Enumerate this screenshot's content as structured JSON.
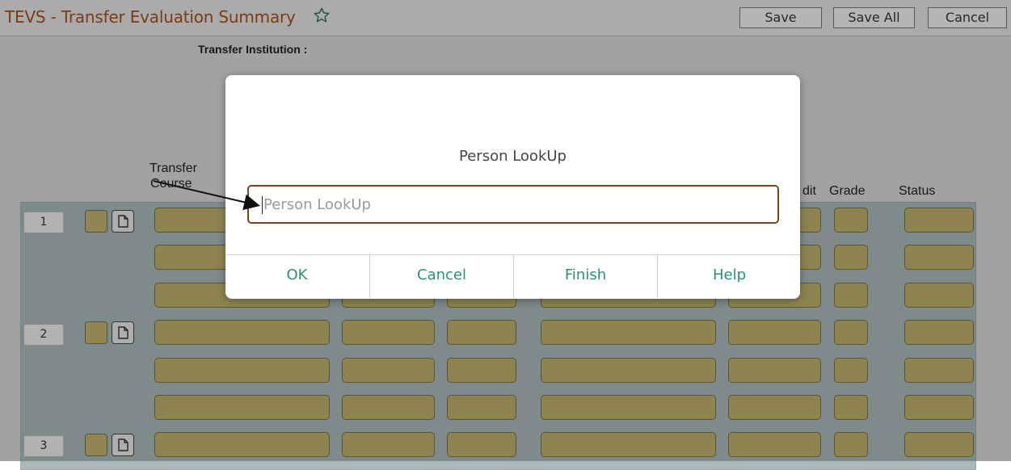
{
  "header": {
    "title": "TEVS - Transfer Evaluation Summary",
    "favorite_icon": "star-outline-icon",
    "buttons": {
      "save": "Save",
      "save_all": "Save All",
      "cancel": "Cancel"
    }
  },
  "subheader": {
    "transfer_institution_label": "Transfer Institution :"
  },
  "grid": {
    "headers": {
      "transfer_course_line1": "Transfer",
      "transfer_course_line2": "Course",
      "credit_partial": "dit",
      "grade": "Grade",
      "status": "Status"
    },
    "rows": [
      {
        "num": "1"
      },
      {
        "num": "2"
      },
      {
        "num": "3"
      }
    ]
  },
  "dialog": {
    "title": "Person LookUp",
    "input_placeholder": "Person LookUp",
    "input_value": "",
    "buttons": {
      "ok": "OK",
      "cancel": "Cancel",
      "finish": "Finish",
      "help": "Help"
    }
  },
  "colors": {
    "title": "#a2511b",
    "field": "#bcb16a",
    "grid_bg": "#a9bab9",
    "dialog_button_text": "#2f8f73",
    "input_border": "#7a4420"
  }
}
